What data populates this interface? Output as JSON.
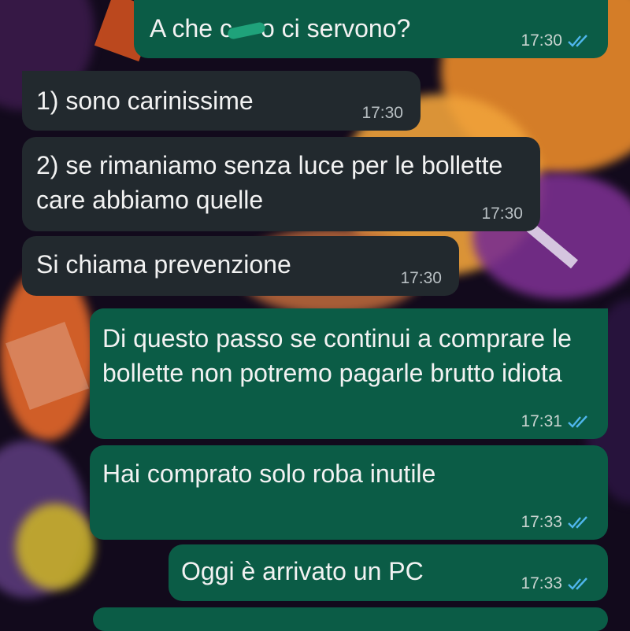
{
  "colors": {
    "incoming_bubble": "#22292e",
    "outgoing_bubble": "#0b5c46",
    "read_ticks": "#4fb6ec",
    "time_text": "#c9d4d0"
  },
  "messages": [
    {
      "direction": "out",
      "text_before": "A che c",
      "censored": true,
      "text_after": "o ci servono?",
      "time": "17:30",
      "status": "read"
    },
    {
      "direction": "in",
      "text": "1) sono carinissime",
      "time": "17:30"
    },
    {
      "direction": "in",
      "text": "2) se rimaniamo senza luce per le bollette care abbiamo quelle",
      "time": "17:30"
    },
    {
      "direction": "in",
      "text": "Si chiama prevenzione",
      "time": "17:30"
    },
    {
      "direction": "out",
      "text": "Di questo passo se continui a comprare le bollette non potremo pagarle brutto idiota",
      "time": "17:31",
      "status": "read"
    },
    {
      "direction": "out",
      "text": "Hai comprato solo roba inutile",
      "time": "17:33",
      "status": "read"
    },
    {
      "direction": "out",
      "text": "Oggi è arrivato un PC",
      "time": "17:33",
      "status": "read"
    }
  ],
  "icons": {
    "read_receipt": "double-check-icon"
  }
}
